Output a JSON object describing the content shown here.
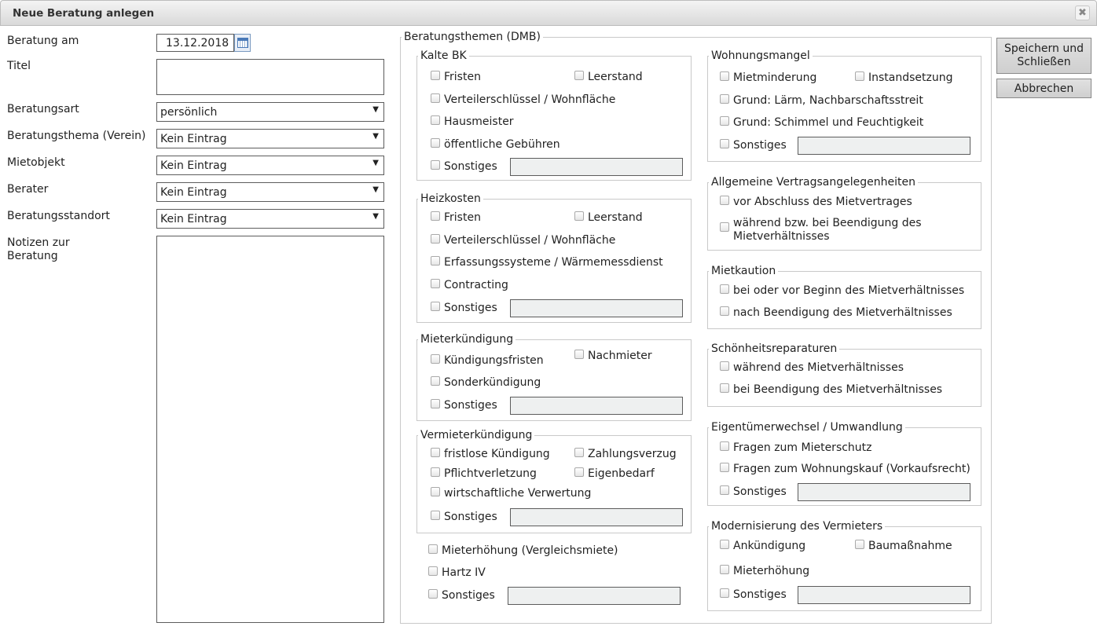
{
  "dialog": {
    "title": "Neue Beratung anlegen",
    "close_glyph": "✖"
  },
  "form": {
    "date_label": "Beratung am",
    "date_value": "13.12.2018",
    "title_label": "Titel",
    "art_label": "Beratungsart",
    "art_value": "persönlich",
    "thema_label": "Beratungsthema (Verein)",
    "thema_value": "Kein Eintrag",
    "objekt_label": "Mietobjekt",
    "objekt_value": "Kein Eintrag",
    "berater_label": "Berater",
    "berater_value": "Kein Eintrag",
    "standort_label": "Beratungsstandort",
    "standort_value": "Kein Eintrag",
    "notes_label_1": "Notizen zur",
    "notes_label_2": "Beratung"
  },
  "themen": {
    "legend": "Beratungsthemen (DMB)",
    "kalte_bk": {
      "legend": "Kalte BK",
      "fristen": "Fristen",
      "leerstand": "Leerstand",
      "verteiler": "Verteilerschlüssel / Wohnfläche",
      "hausmeister": "Hausmeister",
      "gebuehren": "öffentliche Gebühren",
      "sonstiges": "Sonstiges"
    },
    "heizkosten": {
      "legend": "Heizkosten",
      "fristen": "Fristen",
      "leerstand": "Leerstand",
      "verteiler": "Verteilerschlüssel / Wohnfläche",
      "erfassung": "Erfassungssysteme / Wärmemessdienst",
      "contracting": "Contracting",
      "sonstiges": "Sonstiges"
    },
    "mieterkuendigung": {
      "legend": "Mieterkündigung",
      "fristen": "Kündigungsfristen",
      "nachmieter": "Nachmieter",
      "sonder": "Sonderkündigung",
      "sonstiges": "Sonstiges"
    },
    "vermieterkuendigung": {
      "legend": "Vermieterkündigung",
      "fristlos": "fristlose Kündigung",
      "zahlungsverzug": "Zahlungsverzug",
      "pflicht": "Pflichtverletzung",
      "eigenbedarf": "Eigenbedarf",
      "verwertung": "wirtschaftliche Verwertung",
      "sonstiges": "Sonstiges"
    },
    "loose": {
      "mieterhoehung": "Mieterhöhung (Vergleichsmiete)",
      "hartz": "Hartz IV",
      "sonstiges": "Sonstiges"
    },
    "wohnungsmangel": {
      "legend": "Wohnungsmangel",
      "minderung": "Mietminderung",
      "instandsetzung": "Instandsetzung",
      "laerm": "Grund: Lärm, Nachbarschaftsstreit",
      "schimmel": "Grund: Schimmel und Feuchtigkeit",
      "sonstiges": "Sonstiges"
    },
    "vertrag": {
      "legend": "Allgemeine Vertragsangelegenheiten",
      "vor": "vor Abschluss des Mietvertrages",
      "waehrend_1": "während bzw. bei Beendigung des",
      "waehrend_2": "Mietverhältnisses"
    },
    "kaution": {
      "legend": "Mietkaution",
      "beginn": "bei oder vor Beginn des Mietverhältnisses",
      "ende": "nach Beendigung des Mietverhältnisses"
    },
    "schoenheit": {
      "legend": "Schönheitsreparaturen",
      "waehrend": "während des Mietverhältnisses",
      "ende": "bei Beendigung des Mietverhältnisses"
    },
    "eigentuemer": {
      "legend": "Eigentümerwechsel / Umwandlung",
      "schutz": "Fragen zum Mieterschutz",
      "kauf": "Fragen zum Wohnungskauf (Vorkaufsrecht)",
      "sonstiges": "Sonstiges"
    },
    "modernisierung": {
      "legend": "Modernisierung des Vermieters",
      "ankuendigung": "Ankündigung",
      "baumassnahme": "Baumaßnahme",
      "mieterhoehung": "Mieterhöhung",
      "sonstiges": "Sonstiges"
    }
  },
  "buttons": {
    "save_1": "Speichern und",
    "save_2": "Schließen",
    "cancel": "Abbrechen"
  }
}
